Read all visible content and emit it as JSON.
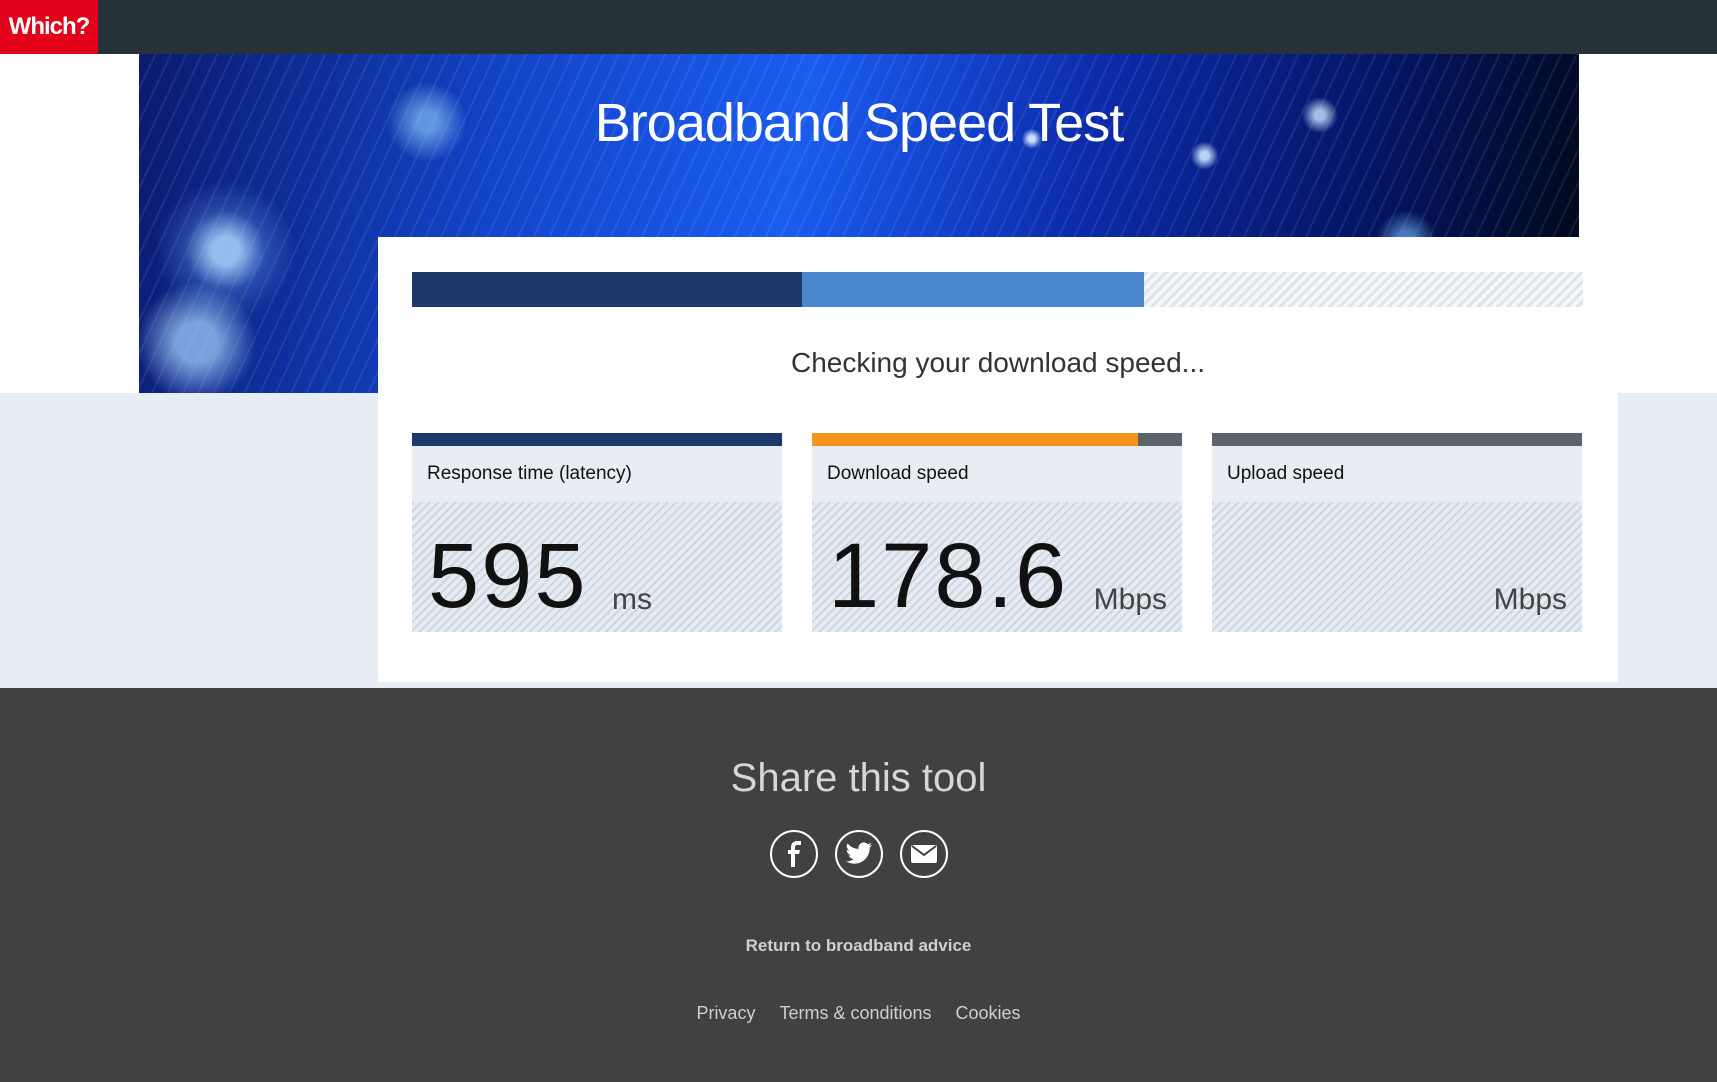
{
  "header": {
    "logo_text": "Which?"
  },
  "hero": {
    "title": "Broadband Speed Test"
  },
  "test": {
    "status": "Checking your download speed...",
    "progress": {
      "latency_fraction": 0.333,
      "download_fraction": 0.292,
      "remaining_fraction": 0.375
    },
    "metrics": [
      {
        "label": "Response time (latency)",
        "value": "595",
        "unit": "ms",
        "bar_color": "#1b3a6b",
        "bar_fill": 1.0
      },
      {
        "label": "Download speed",
        "value": "178.6",
        "unit": "Mbps",
        "bar_color": "#f7941d",
        "bar_fill": 0.88
      },
      {
        "label": "Upload speed",
        "value": "",
        "unit": "Mbps",
        "bar_color": "#5c636b",
        "bar_fill": 0.0
      }
    ]
  },
  "footer": {
    "share_title": "Share this tool",
    "share_icons": [
      "facebook-icon",
      "twitter-icon",
      "email-icon"
    ],
    "return_link": "Return to broadband advice",
    "links": [
      "Privacy",
      "Terms & conditions",
      "Cookies"
    ]
  },
  "colors": {
    "brand_red": "#e2001a",
    "header_dark": "#273238",
    "footer_dark": "#414141",
    "latency_blue": "#1b3a6b",
    "download_blue": "#4b86cc",
    "download_orange": "#f7941d"
  }
}
